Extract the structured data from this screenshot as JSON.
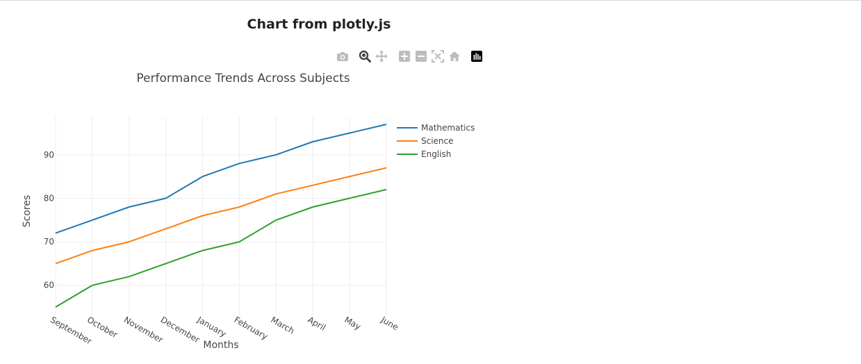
{
  "page": {
    "title": "Chart from plotly.js"
  },
  "modebar": {
    "buttons": [
      {
        "name": "camera-icon",
        "color": "#bdbdbd"
      },
      {
        "name": "zoom-icon",
        "color": "#444444"
      },
      {
        "name": "pan-icon",
        "color": "#bdbdbd"
      },
      {
        "name": "zoom-in-icon",
        "color": "#bdbdbd"
      },
      {
        "name": "zoom-out-icon",
        "color": "#bdbdbd"
      },
      {
        "name": "autoscale-icon",
        "color": "#bdbdbd"
      },
      {
        "name": "reset-axes-icon",
        "color": "#bdbdbd"
      },
      {
        "name": "plotly-logo-icon",
        "color": "#000000"
      }
    ]
  },
  "chart_data": {
    "type": "line",
    "title": "Performance Trends Across Subjects",
    "xlabel": "Months",
    "ylabel": "Scores",
    "categories": [
      "September",
      "October",
      "November",
      "December",
      "January",
      "February",
      "March",
      "April",
      "May",
      "June"
    ],
    "ylim": [
      53.25,
      98.75
    ],
    "yticks": [
      60,
      70,
      80,
      90
    ],
    "grid": true,
    "legend_position": "top-right",
    "series": [
      {
        "name": "Mathematics",
        "color": "#1f77b4",
        "values": [
          72,
          75,
          78,
          80,
          85,
          88,
          90,
          93,
          95,
          97
        ]
      },
      {
        "name": "Science",
        "color": "#ff7f0e",
        "values": [
          65,
          68,
          70,
          73,
          76,
          78,
          81,
          83,
          85,
          87
        ]
      },
      {
        "name": "English",
        "color": "#2ca02c",
        "values": [
          55,
          60,
          62,
          65,
          68,
          70,
          75,
          78,
          80,
          82
        ]
      }
    ]
  }
}
